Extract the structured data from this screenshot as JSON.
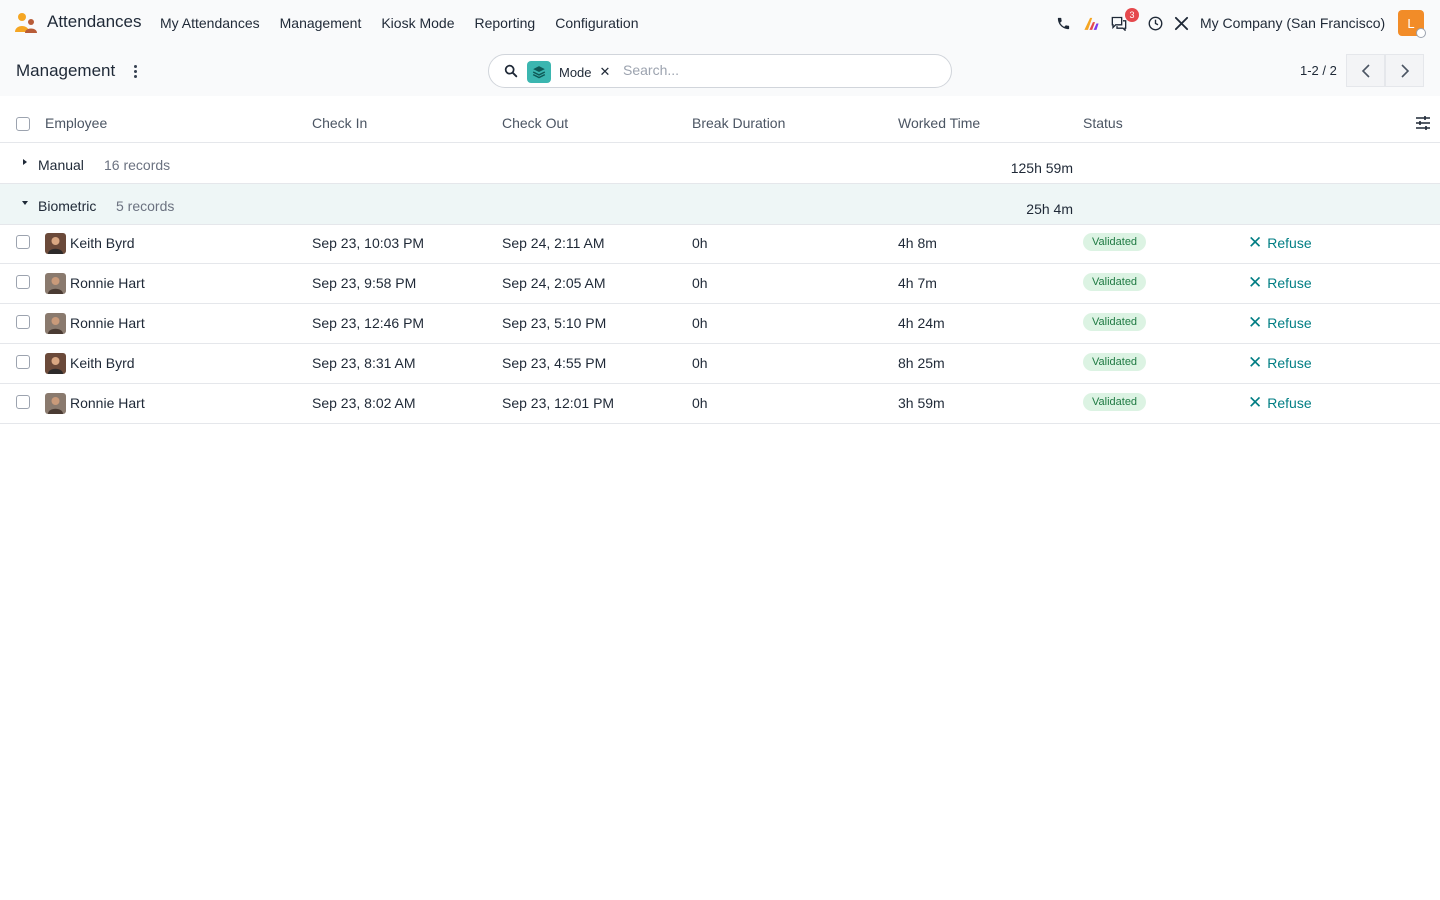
{
  "nav": {
    "app_name": "Attendances",
    "menu": [
      "My Attendances",
      "Management",
      "Kiosk Mode",
      "Reporting",
      "Configuration"
    ],
    "notification_count": "3",
    "company": "My Company (San Francisco)",
    "user_initial": "L",
    "icons": [
      "phone-icon",
      "ai-icon",
      "chat-icon",
      "clock-icon",
      "tools-icon"
    ]
  },
  "control_panel": {
    "breadcrumb": "Management",
    "facet_label": "Mode",
    "search_placeholder": "Search...",
    "pager": "1-2 / 2"
  },
  "table": {
    "columns": [
      "Employee",
      "Check In",
      "Check Out",
      "Break Duration",
      "Worked Time",
      "Status"
    ],
    "groups": [
      {
        "name": "Manual",
        "count": "16 records",
        "total": "125h 59m",
        "expanded": false
      },
      {
        "name": "Biometric",
        "count": "5 records",
        "total": "25h 4m",
        "expanded": true
      }
    ],
    "rows": [
      {
        "employee": "Keith Byrd",
        "check_in": "Sep 23, 10:03 PM",
        "check_out": "Sep 24, 2:11 AM",
        "break": "0h",
        "worked": "4h 8m",
        "status": "Validated",
        "action": "Refuse"
      },
      {
        "employee": "Ronnie Hart",
        "check_in": "Sep 23, 9:58 PM",
        "check_out": "Sep 24, 2:05 AM",
        "break": "0h",
        "worked": "4h 7m",
        "status": "Validated",
        "action": "Refuse"
      },
      {
        "employee": "Ronnie Hart",
        "check_in": "Sep 23, 12:46 PM",
        "check_out": "Sep 23, 5:10 PM",
        "break": "0h",
        "worked": "4h 24m",
        "status": "Validated",
        "action": "Refuse"
      },
      {
        "employee": "Keith Byrd",
        "check_in": "Sep 23, 8:31 AM",
        "check_out": "Sep 23, 4:55 PM",
        "break": "0h",
        "worked": "8h 25m",
        "status": "Validated",
        "action": "Refuse"
      },
      {
        "employee": "Ronnie Hart",
        "check_in": "Sep 23, 8:02 AM",
        "check_out": "Sep 23, 12:01 PM",
        "break": "0h",
        "worked": "3h 59m",
        "status": "Validated",
        "action": "Refuse"
      }
    ]
  },
  "colors": {
    "accent": "#017e84",
    "status_bg": "#dcf3e3",
    "status_text": "#1f7a43",
    "badge": "#e5484d",
    "user_avatar": "#f28c28"
  }
}
